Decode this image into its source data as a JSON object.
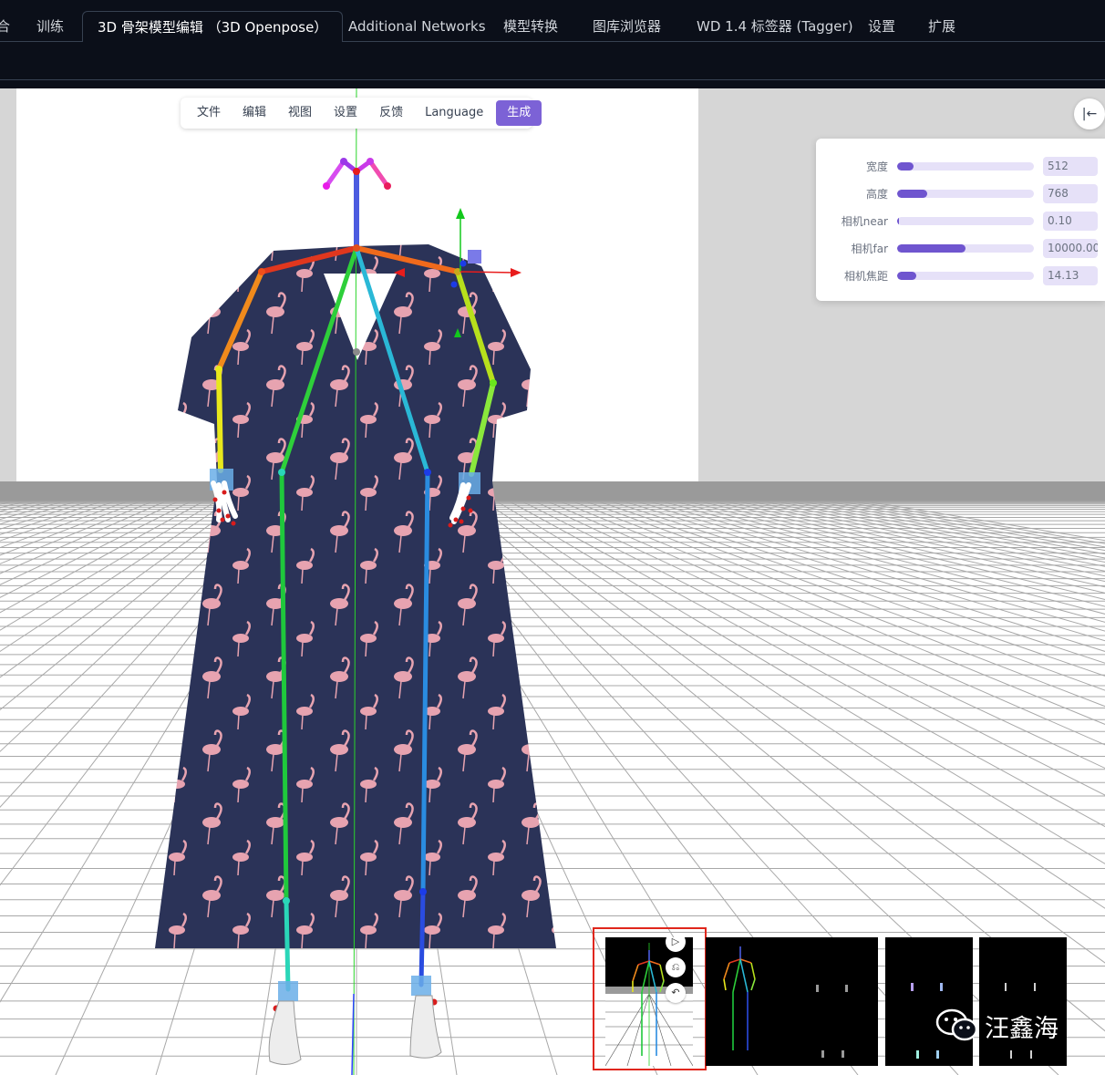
{
  "tabs": [
    {
      "label": "合"
    },
    {
      "label": "训练"
    },
    {
      "label": "3D 骨架模型编辑 （3D Openpose）",
      "active": true
    },
    {
      "label": "Additional Networks"
    },
    {
      "label": "模型转换"
    },
    {
      "label": "图库浏览器"
    },
    {
      "label": "WD 1.4 标签器 (Tagger)"
    },
    {
      "label": "设置"
    },
    {
      "label": "扩展"
    }
  ],
  "menu": {
    "items": [
      "文件",
      "编辑",
      "视图",
      "设置",
      "反馈",
      "Language"
    ],
    "generate": "生成"
  },
  "panel": {
    "collapse_icon": "collapse-left-icon",
    "rows": [
      {
        "label": "宽度",
        "value": "512",
        "fill": 0.12
      },
      {
        "label": "高度",
        "value": "768",
        "fill": 0.22
      },
      {
        "label": "相机near",
        "value": "0.10",
        "fill": 0.0
      },
      {
        "label": "相机far",
        "value": "10000.00",
        "fill": 0.5
      },
      {
        "label": "相机焦距",
        "value": "14.13",
        "fill": 0.14
      }
    ]
  },
  "thumbnail_tools": [
    "play-icon",
    "lock-icon",
    "undo-icon"
  ],
  "watermark": {
    "text": "汪鑫海",
    "icon": "wechat-icon"
  },
  "colors": {
    "accent": "#6f55cf",
    "highlight_box": "#e0261c",
    "dark_bg": "#0b0f19"
  }
}
